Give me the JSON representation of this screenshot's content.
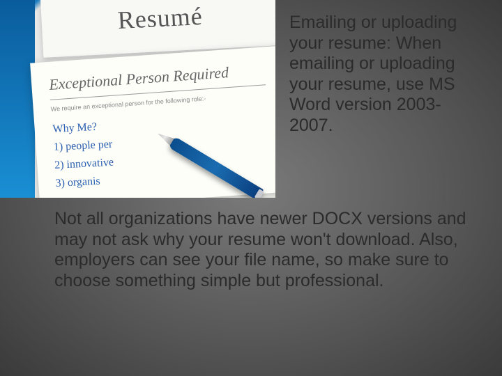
{
  "image": {
    "resume_title": "Resumé",
    "job_header": "Exceptional Person Required",
    "job_subtext": "We require an exceptional person for the following role:-",
    "handwritten": {
      "line1": "Why Me?",
      "line2": "1) people per",
      "line3": "2) innovative",
      "line4": "3) organis"
    }
  },
  "text": {
    "right": "Emailing or uploading your resume: When emailing or uploading your resume, use MS Word version 2003-2007.",
    "bottom": "Not all organizations have newer DOCX versions and may not ask why your resume won't download. Also, employers can see your file name, so make sure to choose something simple but professional."
  }
}
